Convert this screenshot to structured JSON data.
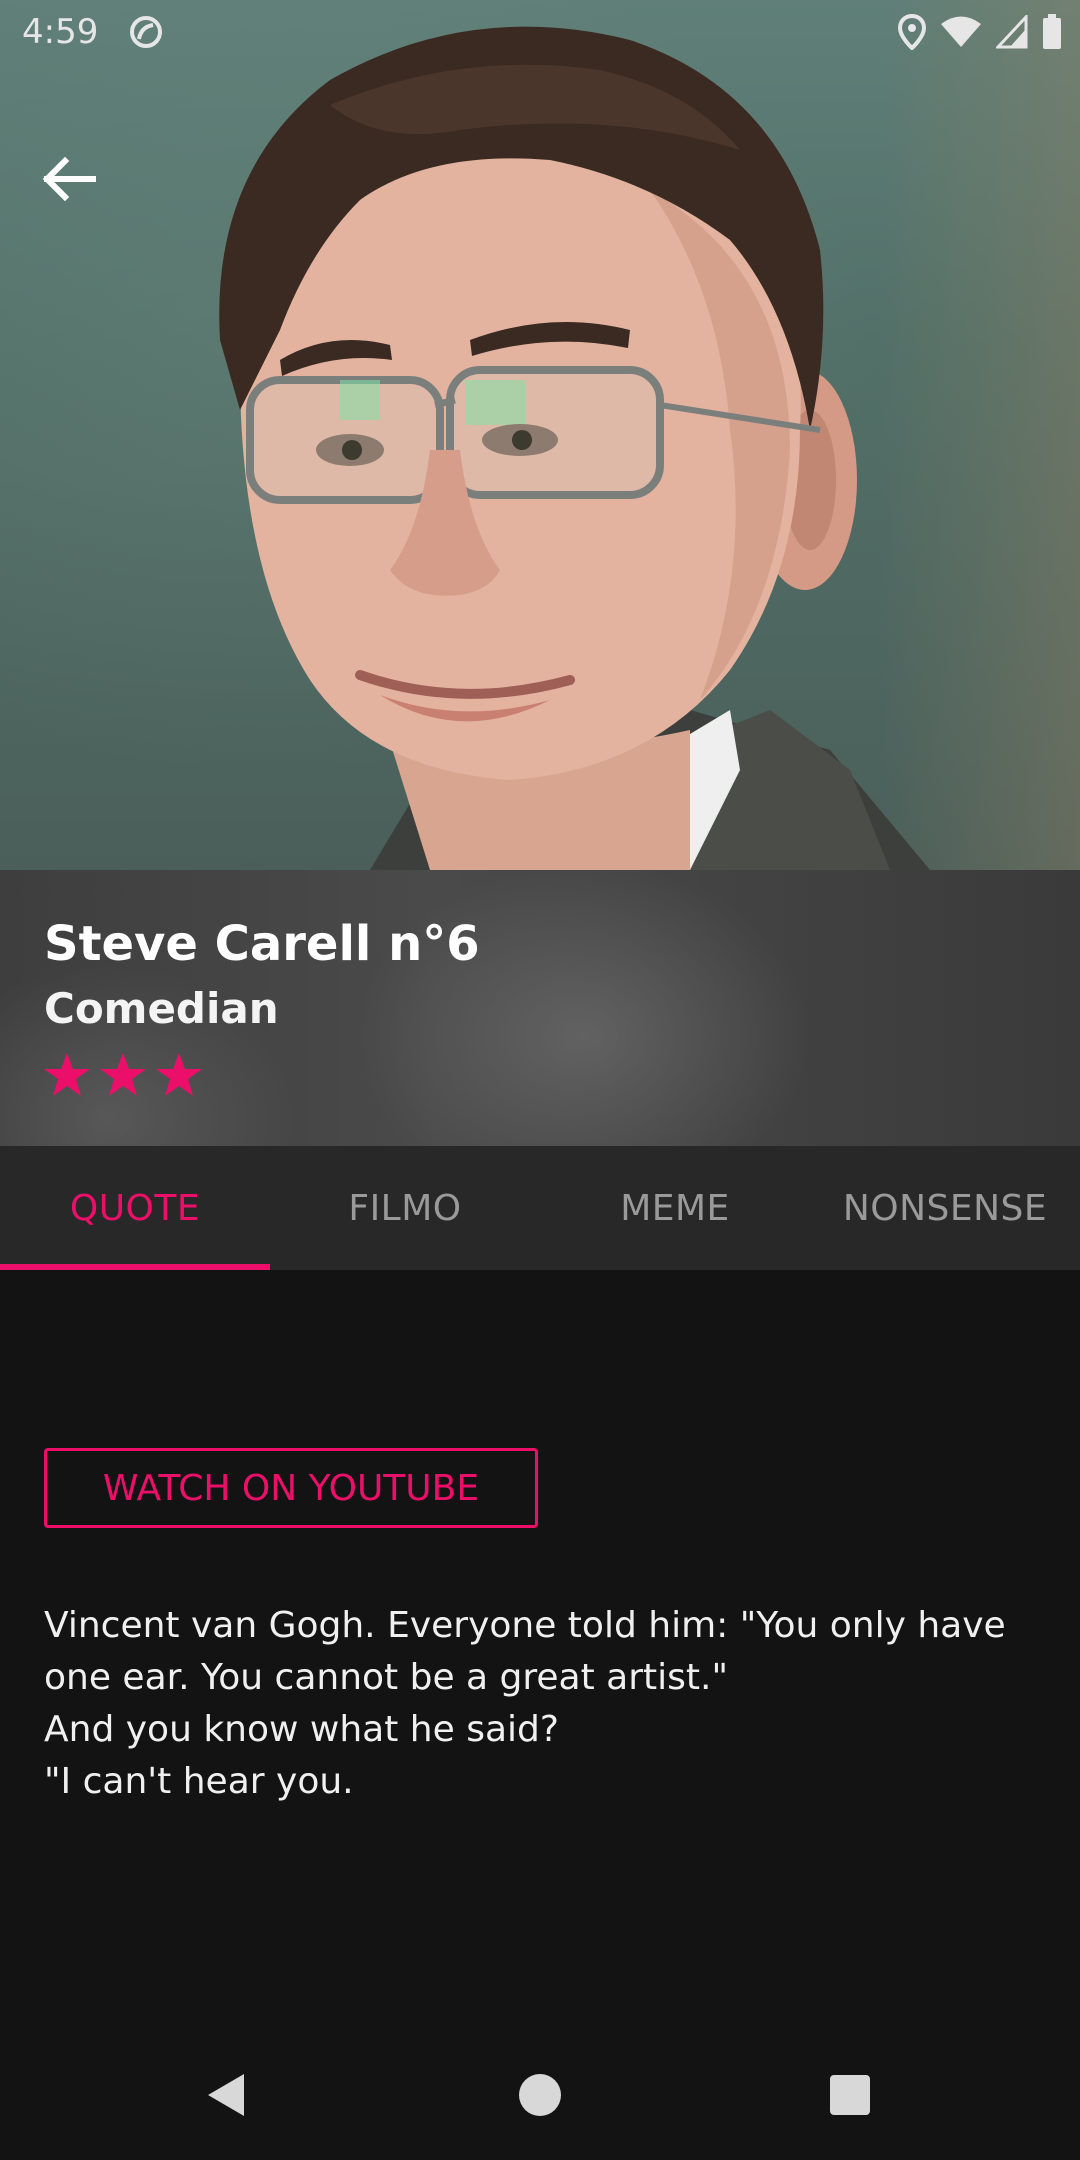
{
  "status_bar": {
    "time": "4:59"
  },
  "icons": {
    "back": "arrow-left-icon",
    "dnd": "do-not-disturb-icon",
    "location": "location-pin-icon",
    "wifi": "wifi-icon",
    "signal": "cell-signal-icon",
    "battery": "battery-icon",
    "star": "star-icon",
    "nav_back": "nav-back-triangle-icon",
    "nav_home": "nav-home-circle-icon",
    "nav_recents": "nav-recents-square-icon"
  },
  "colors": {
    "accent": "#ec0f69",
    "background": "#131313",
    "tab_bar": "#282828",
    "tab_inactive": "#9a9a9a",
    "text": "#f0f0f0"
  },
  "profile": {
    "name": "Steve Carell n°6",
    "role": "Comedian",
    "rating": 3
  },
  "tabs": [
    {
      "label": "QUOTE",
      "active": true
    },
    {
      "label": "FILMO",
      "active": false
    },
    {
      "label": "MEME",
      "active": false
    },
    {
      "label": "NONSENSE",
      "active": false
    }
  ],
  "content": {
    "youtube_button": "WATCH ON YOUTUBE",
    "quote_lines": [
      "Vincent van Gogh. Everyone told him: \"You only have",
      "one ear. You cannot be a great artist.\"",
      "And you know what he said?",
      "\"I can't hear you."
    ]
  }
}
